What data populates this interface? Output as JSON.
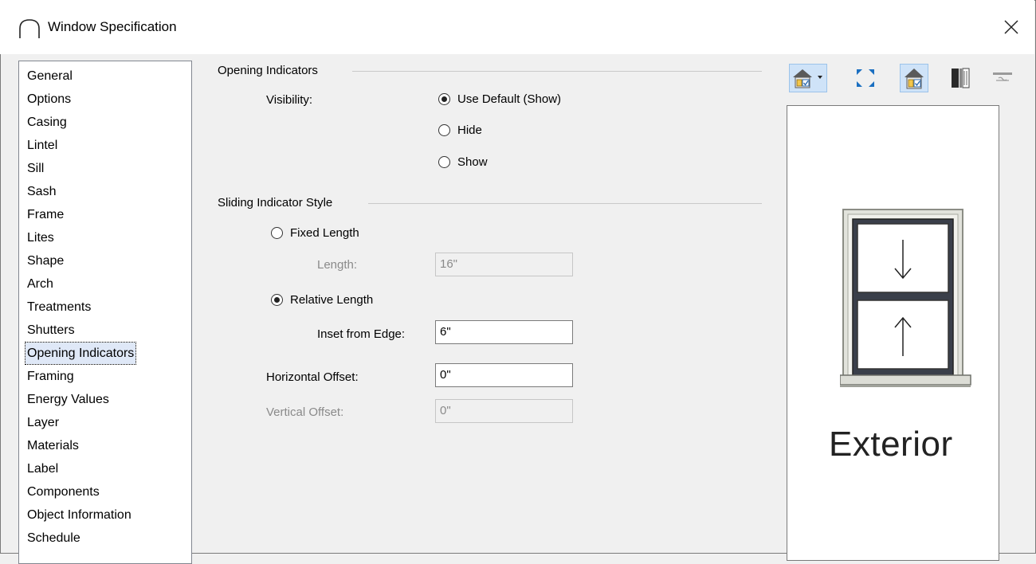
{
  "window": {
    "title": "Window Specification"
  },
  "sidebar": {
    "items": [
      {
        "label": "General"
      },
      {
        "label": "Options"
      },
      {
        "label": "Casing"
      },
      {
        "label": "Lintel"
      },
      {
        "label": "Sill"
      },
      {
        "label": "Sash"
      },
      {
        "label": "Frame"
      },
      {
        "label": "Lites"
      },
      {
        "label": "Shape"
      },
      {
        "label": "Arch"
      },
      {
        "label": "Treatments"
      },
      {
        "label": "Shutters"
      },
      {
        "label": "Opening Indicators"
      },
      {
        "label": "Framing"
      },
      {
        "label": "Energy Values"
      },
      {
        "label": "Layer"
      },
      {
        "label": "Materials"
      },
      {
        "label": "Label"
      },
      {
        "label": "Components"
      },
      {
        "label": "Object Information"
      },
      {
        "label": "Schedule"
      }
    ],
    "selected": "Opening Indicators"
  },
  "opening_indicators": {
    "section_title": "Opening Indicators",
    "visibility_label": "Visibility:",
    "options": [
      {
        "label": "Use Default (Show)",
        "checked": true
      },
      {
        "label": "Hide",
        "checked": false
      },
      {
        "label": "Show",
        "checked": false
      }
    ]
  },
  "sliding": {
    "section_title": "Sliding Indicator Style",
    "fixed_length": {
      "label": "Fixed Length",
      "checked": false
    },
    "length": {
      "label": "Length:",
      "value": "16\"",
      "disabled": true
    },
    "relative_length": {
      "label": "Relative Length",
      "checked": true
    },
    "inset": {
      "label": "Inset from Edge:",
      "value": "6\""
    },
    "horizontal_offset": {
      "label": "Horizontal Offset:",
      "value": "0\""
    },
    "vertical_offset": {
      "label": "Vertical Offset:",
      "value": "0\"",
      "disabled": true
    }
  },
  "preview": {
    "view_label": "Exterior",
    "toolbar": [
      {
        "icon": "house-view-dropdown-icon",
        "active": true
      },
      {
        "icon": "fit-view-icon",
        "active": false
      },
      {
        "icon": "house-checked-icon",
        "active": true
      },
      {
        "icon": "wall-section-icon",
        "active": false
      },
      {
        "icon": "rotate-view-icon",
        "active": false
      }
    ]
  },
  "colors": {
    "accent": "#cfe3f8",
    "selected_item": "#dfe8f7"
  }
}
